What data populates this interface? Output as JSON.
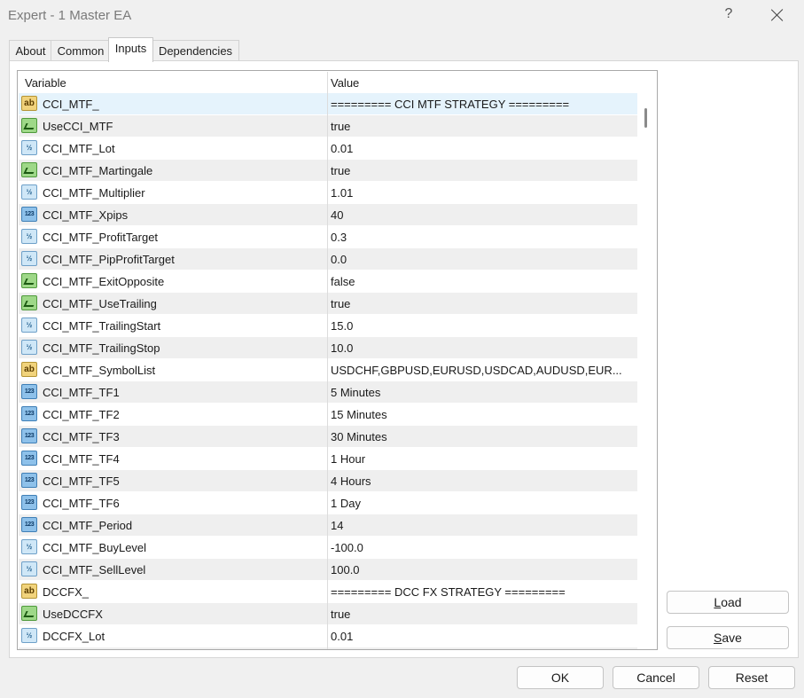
{
  "window": {
    "title": "Expert - 1 Master EA",
    "help_glyph": "?"
  },
  "tabs": [
    {
      "label": "About"
    },
    {
      "label": "Common"
    },
    {
      "label": "Inputs",
      "active": true
    },
    {
      "label": "Dependencies"
    }
  ],
  "grid": {
    "columns": {
      "variable": "Variable",
      "value": "Value"
    },
    "rows": [
      {
        "type": "string",
        "icon": "ab",
        "variable": "CCI_MTF_",
        "value": "========= CCI MTF STRATEGY ========="
      },
      {
        "type": "bool",
        "icon": "",
        "variable": "UseCCI_MTF",
        "value": "true"
      },
      {
        "type": "double",
        "icon": "½",
        "variable": "CCI_MTF_Lot",
        "value": "0.01"
      },
      {
        "type": "bool",
        "icon": "",
        "variable": "CCI_MTF_Martingale",
        "value": "true"
      },
      {
        "type": "double",
        "icon": "½",
        "variable": "CCI_MTF_Multiplier",
        "value": "1.01"
      },
      {
        "type": "int",
        "icon": "123",
        "variable": "CCI_MTF_Xpips",
        "value": "40"
      },
      {
        "type": "double",
        "icon": "½",
        "variable": "CCI_MTF_ProfitTarget",
        "value": "0.3"
      },
      {
        "type": "double",
        "icon": "½",
        "variable": "CCI_MTF_PipProfitTarget",
        "value": "0.0"
      },
      {
        "type": "bool",
        "icon": "",
        "variable": "CCI_MTF_ExitOpposite",
        "value": "false"
      },
      {
        "type": "bool",
        "icon": "",
        "variable": "CCI_MTF_UseTrailing",
        "value": "true"
      },
      {
        "type": "double",
        "icon": "½",
        "variable": "CCI_MTF_TrailingStart",
        "value": "15.0"
      },
      {
        "type": "double",
        "icon": "½",
        "variable": "CCI_MTF_TrailingStop",
        "value": "10.0"
      },
      {
        "type": "string",
        "icon": "ab",
        "variable": "CCI_MTF_SymbolList",
        "value": "USDCHF,GBPUSD,EURUSD,USDCAD,AUDUSD,EUR..."
      },
      {
        "type": "int",
        "icon": "123",
        "variable": "CCI_MTF_TF1",
        "value": "5 Minutes"
      },
      {
        "type": "int",
        "icon": "123",
        "variable": "CCI_MTF_TF2",
        "value": "15 Minutes"
      },
      {
        "type": "int",
        "icon": "123",
        "variable": "CCI_MTF_TF3",
        "value": "30 Minutes"
      },
      {
        "type": "int",
        "icon": "123",
        "variable": "CCI_MTF_TF4",
        "value": "1 Hour"
      },
      {
        "type": "int",
        "icon": "123",
        "variable": "CCI_MTF_TF5",
        "value": "4 Hours"
      },
      {
        "type": "int",
        "icon": "123",
        "variable": "CCI_MTF_TF6",
        "value": "1 Day"
      },
      {
        "type": "int",
        "icon": "123",
        "variable": "CCI_MTF_Period",
        "value": "14"
      },
      {
        "type": "double",
        "icon": "½",
        "variable": "CCI_MTF_BuyLevel",
        "value": "-100.0"
      },
      {
        "type": "double",
        "icon": "½",
        "variable": "CCI_MTF_SellLevel",
        "value": "100.0"
      },
      {
        "type": "string",
        "icon": "ab",
        "variable": "DCCFX_",
        "value": "========= DCC FX STRATEGY ========="
      },
      {
        "type": "bool",
        "icon": "",
        "variable": "UseDCCFX",
        "value": "true"
      },
      {
        "type": "double",
        "icon": "½",
        "variable": "DCCFX_Lot",
        "value": "0.01"
      },
      {
        "type": "bool",
        "icon": "",
        "variable": "",
        "value": ""
      }
    ]
  },
  "side_buttons": {
    "load": {
      "mnemonic": "L",
      "rest": "oad"
    },
    "save": {
      "mnemonic": "S",
      "rest": "ave"
    }
  },
  "footer": {
    "ok": "OK",
    "cancel": "Cancel",
    "reset": "Reset"
  }
}
